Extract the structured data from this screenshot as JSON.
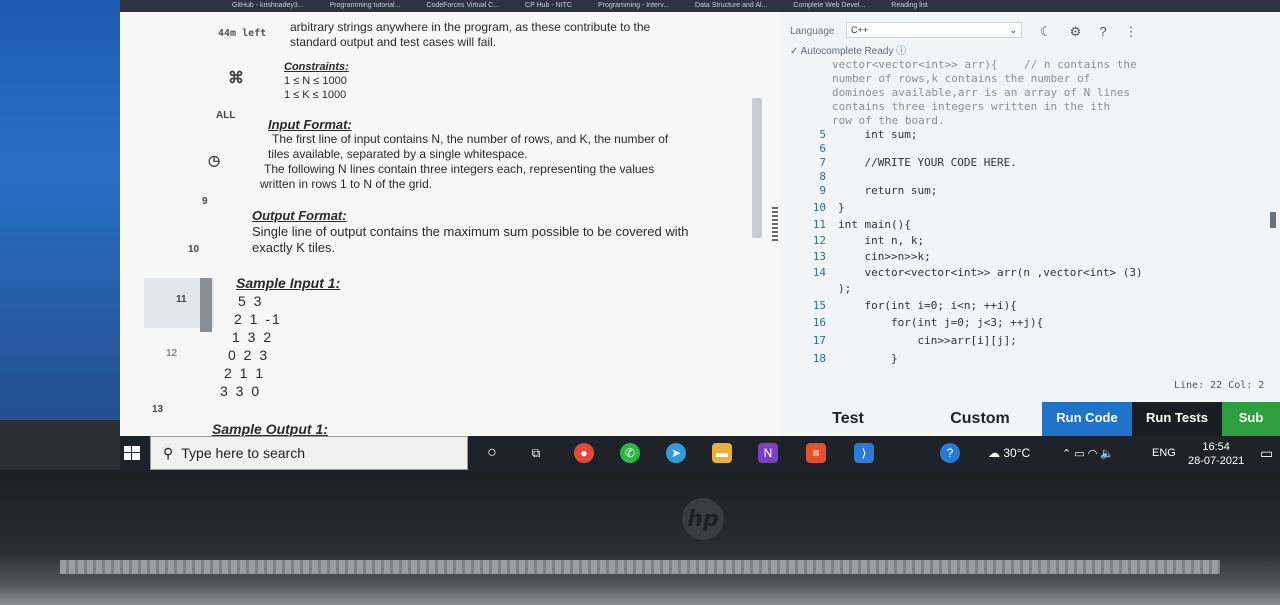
{
  "browser_tabs": [
    "GitHub - krishnadey3...",
    "Programming tutorial...",
    "CodeForces Virtual C...",
    "CP Hub - NITC",
    "Programming - Interv...",
    "Data Structure and Al...",
    "Complete Web Devel...",
    "Reading list"
  ],
  "left_rail": {
    "time_left": "44m left",
    "cmd": "⌘",
    "all": "ALL",
    "numbers": [
      "9",
      "10",
      "11",
      "12",
      "13"
    ]
  },
  "statement": {
    "intro_line1": "arbitrary strings anywhere in the program, as these contribute to the",
    "intro_line2": "standard output and test cases will fail.",
    "constraints_title": "Constraints:",
    "constraint1": "1 ≤ N ≤ 1000",
    "constraint2": "1 ≤ K ≤ 1000",
    "input_title": "Input Format:",
    "input1": "The first line of input contains N, the number of rows, and K, the number of",
    "input2": "tiles available, separated by a single whitespace.",
    "input3": "The following N lines contain three integers each, representing the values",
    "input4": "written in rows 1 to N of the grid.",
    "output_title": "Output Format:",
    "output1": "Single line of output contains the maximum sum possible to be covered with",
    "output2": "exactly K tiles.",
    "sample_in_title": "Sample Input 1:",
    "sample_lines": [
      "5 3",
      "2 1 -1",
      "1 3 2",
      "0 2 3",
      "2 1 1",
      "3 3 0"
    ],
    "sample_out_title": "Sample Output 1:"
  },
  "editor": {
    "language_label": "Language",
    "language_value": "C++",
    "autocomplete": "Autocomplete Ready",
    "status": "Line: 22 Col: 2",
    "code_lines": [
      {
        "n": "",
        "text": "vector<vector<int>> arr){    // n contains the"
      },
      {
        "n": "",
        "text": "number of rows,k contains the number of"
      },
      {
        "n": "",
        "text": "dominoes available,arr is an array of N lines"
      },
      {
        "n": "",
        "text": "contains three integers written in the ith"
      },
      {
        "n": "",
        "text": "row of the board."
      },
      {
        "n": "5",
        "text": "    int sum;"
      },
      {
        "n": "6",
        "text": ""
      },
      {
        "n": "7",
        "text": "    //WRITE YOUR CODE HERE."
      },
      {
        "n": "8",
        "text": ""
      },
      {
        "n": "9",
        "text": "    return sum;"
      },
      {
        "n": "10",
        "text": "}"
      },
      {
        "n": "11",
        "text": "int main(){"
      },
      {
        "n": "12",
        "text": "    int n, k;"
      },
      {
        "n": "13",
        "text": "    cin>>n>>k;"
      },
      {
        "n": "14",
        "text": "    vector<vector<int>> arr(n ,vector<int> (3)"
      },
      {
        "n": "",
        "text": ");"
      },
      {
        "n": "15",
        "text": "    for(int i=0; i<n; ++i){"
      },
      {
        "n": "16",
        "text": "        for(int j=0; j<3; ++j){"
      },
      {
        "n": "17",
        "text": "            cin>>arr[i][j];"
      },
      {
        "n": "18",
        "text": "        }"
      }
    ]
  },
  "buttons": {
    "test": "Test",
    "custom": "Custom",
    "run_code": "Run Code",
    "run_tests": "Run Tests",
    "submit": "Sub"
  },
  "taskbar": {
    "search_placeholder": "Type here to search",
    "temp": "30°C",
    "lang": "ENG",
    "time": "16:54",
    "date": "28-07-2021"
  },
  "colors": {
    "accent_blue": "#1f74c9",
    "submit_green": "#2f9e3f",
    "tab_bar": "#2d3440",
    "taskbar": "#1f2329"
  }
}
